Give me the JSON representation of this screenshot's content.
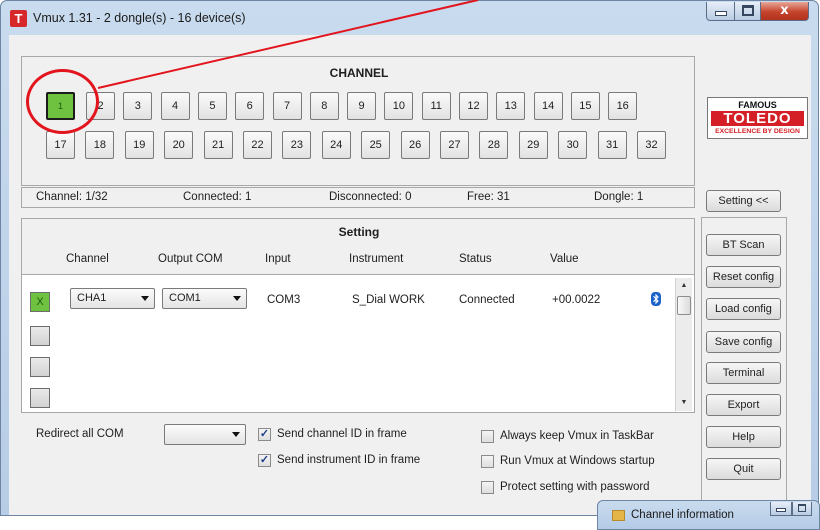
{
  "window": {
    "icon_letter": "T",
    "title": "Vmux 1.31 - 2 dongle(s) - 16 device(s)",
    "close_glyph": "x"
  },
  "channel_panel": {
    "title": "CHANNEL",
    "active_label": "1",
    "row1": [
      "2",
      "3",
      "4",
      "5",
      "6",
      "7",
      "8",
      "9",
      "10",
      "11",
      "12",
      "13",
      "14",
      "15",
      "16"
    ],
    "row2": [
      "17",
      "18",
      "19",
      "20",
      "21",
      "22",
      "23",
      "24",
      "25",
      "26",
      "27",
      "28",
      "29",
      "30",
      "31",
      "32"
    ]
  },
  "logo": {
    "line1": "FAMOUS",
    "line2": "TOLEDO",
    "tagline": "EXCELLENCE BY DESIGN"
  },
  "status": {
    "channel": "Channel: 1/32",
    "connected": "Connected: 1",
    "disconnected": "Disconnected: 0",
    "free": "Free: 31",
    "dongle": "Dongle: 1"
  },
  "setting_panel": {
    "title": "Setting",
    "headers": {
      "channel": "Channel",
      "output_com": "Output COM",
      "input": "Input",
      "instrument": "Instrument",
      "status": "Status",
      "value": "Value"
    },
    "row": {
      "check": "X",
      "channel": "CHA1",
      "output_com": "COM1",
      "input": "COM3",
      "instrument": "S_Dial WORK",
      "status": "Connected",
      "value": "+00.0022",
      "icon": "bluetooth-icon"
    }
  },
  "bottom": {
    "redirect_label": "Redirect all COM",
    "redirect_value": "",
    "send_channel_id": "Send channel ID in frame",
    "send_instrument_id": "Send instrument ID in frame",
    "keep_taskbar": "Always keep Vmux in TaskBar",
    "run_startup": "Run Vmux at Windows startup",
    "protect": "Protect setting with password",
    "check_glyph": "✓"
  },
  "buttons": {
    "setting": "Setting <<",
    "bt_scan": "BT Scan",
    "reset_config": "Reset config",
    "load_config": "Load config",
    "save_config": "Save config",
    "terminal": "Terminal",
    "export": "Export",
    "help": "Help",
    "quit": "Quit"
  },
  "child_window": {
    "title": "Channel information"
  },
  "colors": {
    "active_green": "#6fc23f",
    "annotation_red": "#e2141d",
    "brand_red": "#d31f25"
  }
}
